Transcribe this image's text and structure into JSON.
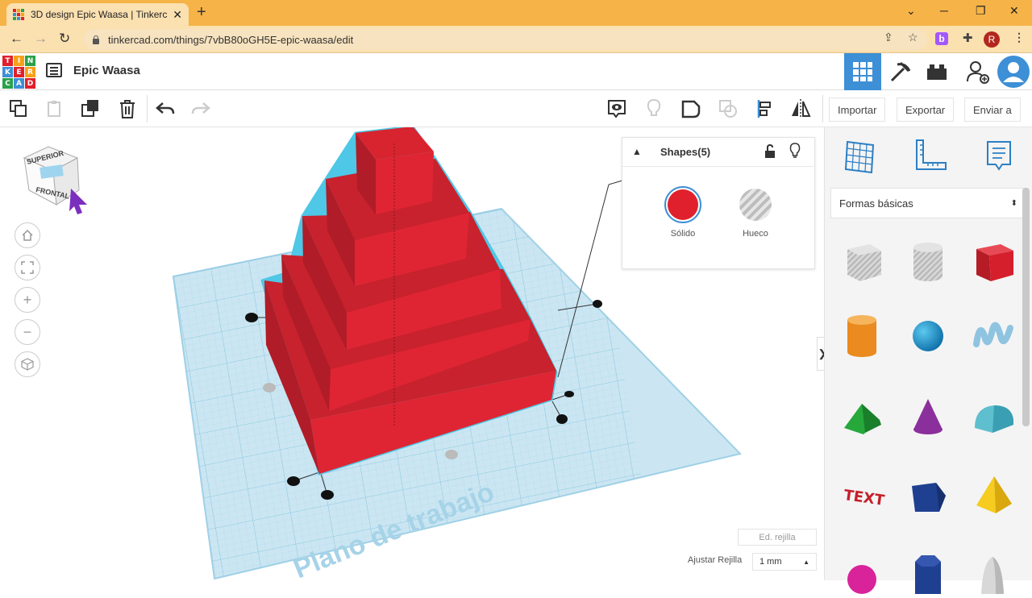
{
  "browser": {
    "tab_title": "3D design Epic Waasa | Tinkercad",
    "url": "tinkercad.com/things/7vbB80oGH5E-epic-waasa/edit",
    "profile_initial": "R",
    "extension_letter": "b"
  },
  "app": {
    "logo_letters": [
      "TIN",
      "KER",
      "CAD"
    ],
    "design_title": "Epic Waasa"
  },
  "toolbar": {
    "import_label": "Importar",
    "export_label": "Exportar",
    "send_label": "Enviar a"
  },
  "viewcube": {
    "top_label": "SUPERIOR",
    "front_label": "FRONTAL"
  },
  "inspector": {
    "title": "Shapes(5)",
    "solid_label": "Sólido",
    "hole_label": "Hueco"
  },
  "workplane": {
    "watermark": "Plano de trabajo",
    "edit_grid_label": "Ed. rejilla",
    "snap_label": "Ajustar Rejilla",
    "snap_value": "1 mm"
  },
  "shapes_panel": {
    "category": "Formas básicas",
    "shapes": [
      "box-hole",
      "cylinder-hole",
      "box",
      "cylinder",
      "sphere",
      "scribble",
      "roof",
      "cone",
      "round-roof",
      "text",
      "prism",
      "pyramid",
      "half-sphere",
      "polygon",
      "paraboloid"
    ]
  },
  "colors": {
    "accent": "#3d8fd6",
    "shape_red": "#e0202c",
    "workplane": "#cbe6f2",
    "tab_bar": "#f6b347"
  }
}
